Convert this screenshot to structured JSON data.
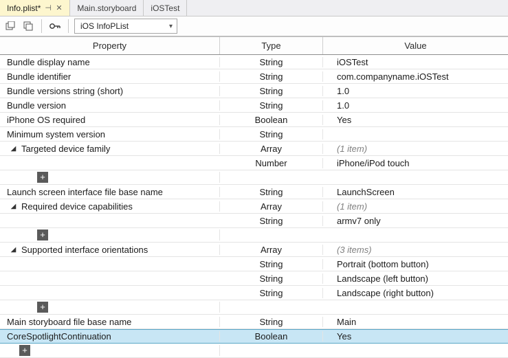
{
  "tabs": {
    "active": {
      "label": "Info.plist*"
    },
    "inactive1": {
      "label": "Main.storyboard"
    },
    "inactive2": {
      "label": "iOSTest"
    }
  },
  "toolbar": {
    "dropdown": "iOS InfoPList"
  },
  "columns": {
    "property": "Property",
    "type": "Type",
    "value": "Value"
  },
  "rows": {
    "r0": {
      "prop": "Bundle display name",
      "type": "String",
      "val": "iOSTest"
    },
    "r1": {
      "prop": "Bundle identifier",
      "type": "String",
      "val": "com.companyname.iOSTest"
    },
    "r2": {
      "prop": "Bundle versions string (short)",
      "type": "String",
      "val": "1.0"
    },
    "r3": {
      "prop": "Bundle version",
      "type": "String",
      "val": "1.0"
    },
    "r4": {
      "prop": "iPhone OS required",
      "type": "Boolean",
      "val": "Yes"
    },
    "r5": {
      "prop": "Minimum system version",
      "type": "String",
      "val": ""
    },
    "r6": {
      "prop": "Targeted device family",
      "type": "Array",
      "val": "(1 item)"
    },
    "r6a": {
      "prop": "",
      "type": "Number",
      "val": "iPhone/iPod touch"
    },
    "r7": {
      "prop": "Launch screen interface file base name",
      "type": "String",
      "val": "LaunchScreen"
    },
    "r8": {
      "prop": "Required device capabilities",
      "type": "Array",
      "val": "(1 item)"
    },
    "r8a": {
      "prop": "",
      "type": "String",
      "val": "armv7 only"
    },
    "r9": {
      "prop": "Supported interface orientations",
      "type": "Array",
      "val": "(3 items)"
    },
    "r9a": {
      "prop": "",
      "type": "String",
      "val": "Portrait (bottom button)"
    },
    "r9b": {
      "prop": "",
      "type": "String",
      "val": "Landscape (left button)"
    },
    "r9c": {
      "prop": "",
      "type": "String",
      "val": "Landscape (right button)"
    },
    "r10": {
      "prop": "Main storyboard file base name",
      "type": "String",
      "val": "Main"
    },
    "r11": {
      "prop": "CoreSpotlightContinuation",
      "type": "Boolean",
      "val": "Yes"
    }
  }
}
